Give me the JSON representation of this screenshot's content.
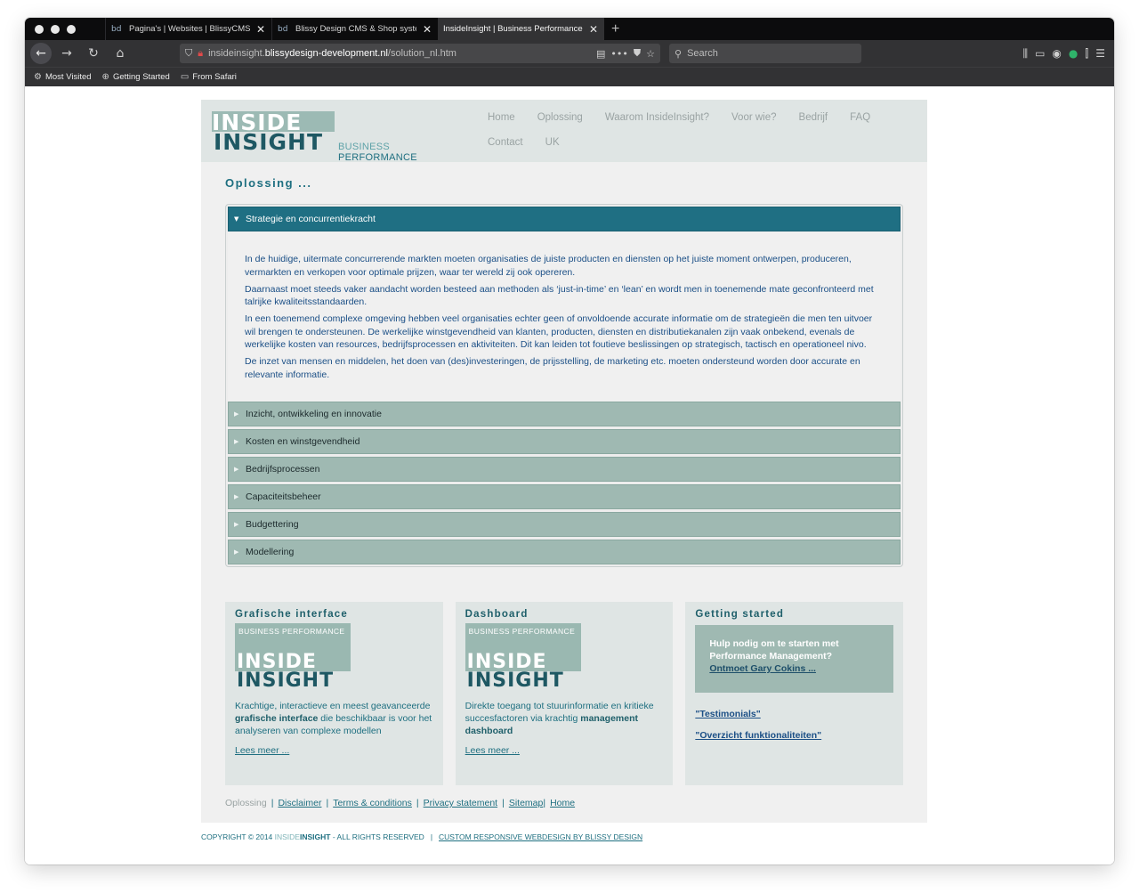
{
  "browser": {
    "tabs": [
      {
        "icon": "bd",
        "title": "Pagina's | Websites | BlissyCMS",
        "active": false
      },
      {
        "icon": "bd",
        "title": "Blissy Design CMS & Shop system",
        "active": false
      },
      {
        "icon": "",
        "title": "InsideInsight | Business Performance",
        "active": true
      }
    ],
    "url_prefix": "insideinsight.",
    "url_domain": "blissydesign-development.nl",
    "url_path": "/solution_nl.htm",
    "search_placeholder": "Search",
    "bookmarks": [
      "Most Visited",
      "Getting Started",
      "From Safari"
    ]
  },
  "site": {
    "logo_inside": "INSIDE",
    "logo_insight": "INSIGHT",
    "logo_tag_light": "BUSINESS ",
    "logo_tag_dark": "PERFORMANCE",
    "nav": [
      "Home",
      "Oplossing",
      "Waarom InsideInsight?",
      "Voor wie?",
      "Bedrijf",
      "FAQ",
      "Contact",
      "UK"
    ],
    "page_title": "Oplossing ...",
    "accordion": {
      "open_title": "Strategie en concurrentiekracht",
      "paragraphs": [
        "In de huidige, uitermate concurrerende markten moeten organisaties de juiste producten en diensten op het juiste moment ontwerpen, produceren, vermarkten en verkopen voor optimale prijzen, waar ter wereld zij ook opereren.",
        "Daarnaast moet steeds vaker aandacht worden besteed aan methoden als ‘just-in-time’ en ‘lean’ en wordt men in toenemende mate geconfronteerd met talrijke kwaliteitsstandaarden.",
        "In een toenemend complexe omgeving hebben veel organisaties echter geen of onvoldoende accurate informatie om de strategieën die men ten uitvoer wil brengen te ondersteunen. De werkelijke winstgevendheid van klanten, producten, diensten en distributiekanalen zijn vaak onbekend, evenals de werkelijke kosten van resources, bedrijfsprocessen en aktiviteiten. Dit kan leiden tot foutieve beslissingen op strategisch, tactisch en operationeel nivo.",
        "De inzet van mensen en middelen, het doen van (des)investeringen, de prijsstelling, de marketing etc. moeten ondersteund worden door accurate en relevante informatie."
      ],
      "closed": [
        "Inzicht, ontwikkeling en innovatie",
        "Kosten en winstgevendheid",
        "Bedrijfsprocessen",
        "Capaciteitsbeheer",
        "Budgettering",
        "Modellering"
      ]
    },
    "cards": {
      "grafisch": {
        "title": "Grafische interface",
        "logo_tag": "BUSINESS PERFORMANCE",
        "text_before": "Krachtige, interactieve en meest geavanceerde ",
        "text_bold": "grafische interface",
        "text_after": " die beschikbaar is voor het analyseren van complexe modellen",
        "link": "Lees meer ..."
      },
      "dashboard": {
        "title": "Dashboard",
        "logo_tag": "BUSINESS PERFORMANCE",
        "text_before": "Direkte toegang tot stuurinformatie en kritieke succesfactoren via krachtig ",
        "text_bold": "management dashboard",
        "link": "Lees meer ..."
      },
      "getting_started": {
        "title": "Getting started",
        "help_text": "Hulp nodig om te starten met Performance Management?",
        "help_link": "Ontmoet Gary Cokins ...",
        "link1": "\"Testimonials\"",
        "link2": "\"Overzicht funktionaliteiten\""
      }
    },
    "footer": {
      "current": "Oplossing",
      "links": [
        "Disclaimer",
        "Terms & conditions",
        "Privacy statement",
        "Sitemap",
        "Home"
      ]
    },
    "copyright": {
      "prefix": "COPYRIGHT © 2014 ",
      "brand_light": "INSIDE",
      "brand_dark": "INSIGHT",
      "suffix": " - ALL RIGHTS RESERVED",
      "link": "CUSTOM RESPONSIVE WEBDESIGN BY BLISSY DESIGN"
    }
  }
}
